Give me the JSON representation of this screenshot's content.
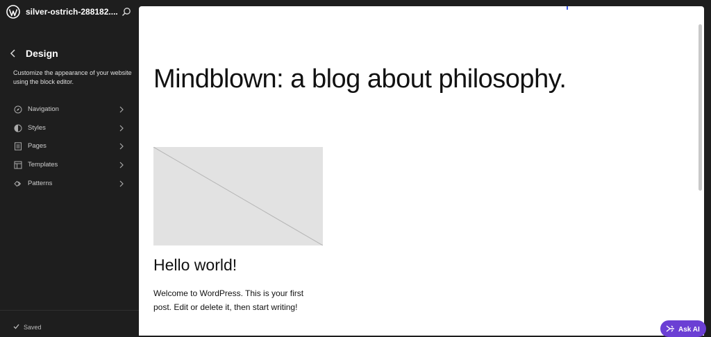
{
  "header": {
    "site_name": "silver-ostrich-288182....",
    "logo_icon": "wordpress-logo-icon",
    "search_icon": "search-icon"
  },
  "sidebar": {
    "title": "Design",
    "description": "Customize the appearance of your website using the block editor.",
    "items": [
      {
        "label": "Navigation",
        "icon": "compass-icon"
      },
      {
        "label": "Styles",
        "icon": "half-circle-icon"
      },
      {
        "label": "Pages",
        "icon": "page-icon"
      },
      {
        "label": "Templates",
        "icon": "layout-icon"
      },
      {
        "label": "Patterns",
        "icon": "diamond-icon"
      }
    ],
    "status": "Saved"
  },
  "canvas": {
    "blog_title": "Mindblown: a blog about philosophy.",
    "post_title": "Hello world!",
    "post_excerpt": "Welcome to WordPress. This is your first post. Edit or delete it, then start writing!"
  },
  "ask_ai": {
    "label": "Ask AI"
  },
  "colors": {
    "sidebar_bg": "#1e1e1e",
    "canvas_bg": "#ffffff",
    "ask_ai_bg": "#6b3fd4",
    "placeholder_bg": "#e2e2e2"
  }
}
